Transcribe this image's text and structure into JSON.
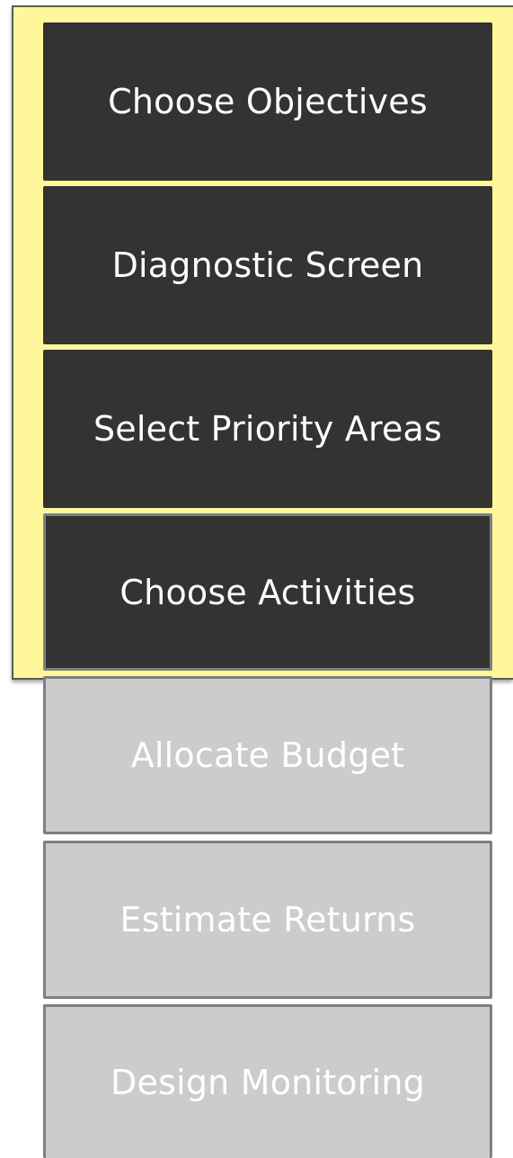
{
  "steps": [
    {
      "label": "Choose Objectives",
      "state": "active"
    },
    {
      "label": "Diagnostic Screen",
      "state": "active"
    },
    {
      "label": "Select Priority Areas",
      "state": "active"
    },
    {
      "label": "Choose Activities",
      "state": "active"
    },
    {
      "label": "Allocate Budget",
      "state": "inactive"
    },
    {
      "label": "Estimate Returns",
      "state": "inactive"
    },
    {
      "label": "Design Monitoring",
      "state": "inactive"
    }
  ],
  "colors": {
    "highlight": "#fff799",
    "active_box": "#333333",
    "inactive_box": "#cccccc",
    "box_border": "#7f7f7f",
    "text": "#ffffff"
  }
}
